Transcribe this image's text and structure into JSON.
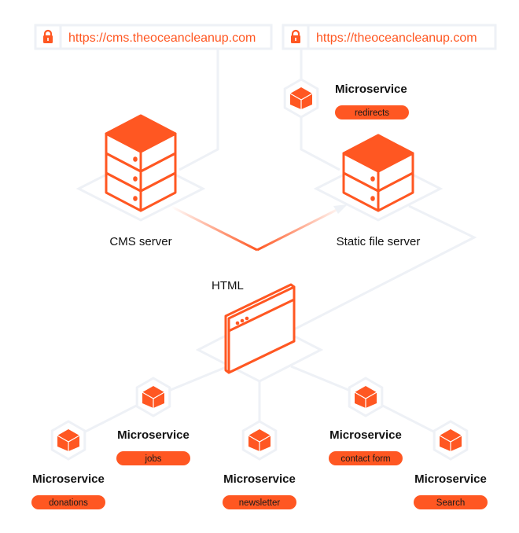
{
  "colors": {
    "accent": "#ff5722",
    "line": "#eef1f6",
    "text": "#111111"
  },
  "urls": [
    {
      "icon": "lock-icon",
      "text": "https://cms.theoceancleanup.com"
    },
    {
      "icon": "lock-icon",
      "text": "https://theoceancleanup.com"
    }
  ],
  "servers": [
    {
      "label": "CMS server",
      "icon": "server-stack-icon"
    },
    {
      "label": "Static file server",
      "icon": "server-stack-icon"
    }
  ],
  "html_node": {
    "label": "HTML",
    "icon": "browser-window-icon"
  },
  "microservices": [
    {
      "title": "Microservice",
      "tag": "redirects",
      "icon": "cube-icon"
    },
    {
      "title": "Microservice",
      "tag": "jobs",
      "icon": "cube-icon"
    },
    {
      "title": "Microservice",
      "tag": "donations",
      "icon": "cube-icon"
    },
    {
      "title": "Microservice",
      "tag": "newsletter",
      "icon": "cube-icon"
    },
    {
      "title": "Microservice",
      "tag": "contact form",
      "icon": "cube-icon"
    },
    {
      "title": "Microservice",
      "tag": "Search",
      "icon": "cube-icon"
    }
  ]
}
